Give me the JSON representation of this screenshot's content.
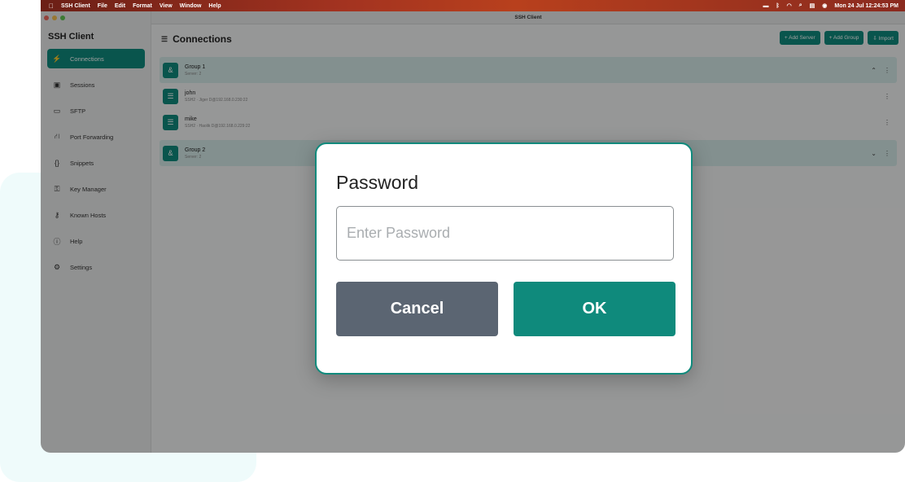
{
  "menubar": {
    "apple_icon": "apple-logo",
    "items": [
      "SSH Client",
      "File",
      "Edit",
      "Format",
      "View",
      "Window",
      "Help"
    ],
    "clock": "Mon 24 Jul  12:24:53 PM"
  },
  "window": {
    "title": "SSH Client"
  },
  "sidebar": {
    "app_title": "SSH Client",
    "items": [
      {
        "label": "Connections",
        "icon": "plug-icon",
        "glyph": "⚡",
        "active": true
      },
      {
        "label": "Sessions",
        "icon": "terminal-icon",
        "glyph": "▣"
      },
      {
        "label": "SFTP",
        "icon": "folder-icon",
        "glyph": "▭"
      },
      {
        "label": "Port Forwarding",
        "icon": "network-icon",
        "glyph": "⛙"
      },
      {
        "label": "Snippets",
        "icon": "braces-icon",
        "glyph": "{}"
      },
      {
        "label": "Key Manager",
        "icon": "key-icon",
        "glyph": "⚿"
      },
      {
        "label": "Known Hosts",
        "icon": "key-hosts-icon",
        "glyph": "⚷"
      },
      {
        "label": "Help",
        "icon": "help-icon",
        "glyph": "ⓘ"
      },
      {
        "label": "Settings",
        "icon": "gear-icon",
        "glyph": "⚙"
      }
    ]
  },
  "main": {
    "title": "Connections",
    "actions": {
      "add_server": "+ Add Server",
      "add_group": "+ Add Group",
      "import": "⇩ Import"
    },
    "groups": [
      {
        "name": "Group 1",
        "sub": "Server: 2",
        "servers": [
          {
            "name": "john",
            "sub": "SSH2 · Jiger D@192.168.0.230:22"
          },
          {
            "name": "mike",
            "sub": "SSH2 · Haolik D@192.168.0.229:22"
          }
        ]
      },
      {
        "name": "Group 2",
        "sub": "Server: 2"
      }
    ]
  },
  "dialog": {
    "title": "Password",
    "input_placeholder": "Enter Password",
    "cancel_label": "Cancel",
    "ok_label": "OK"
  },
  "colors": {
    "accent": "#0f8a7c",
    "cancel": "#5b6572"
  }
}
